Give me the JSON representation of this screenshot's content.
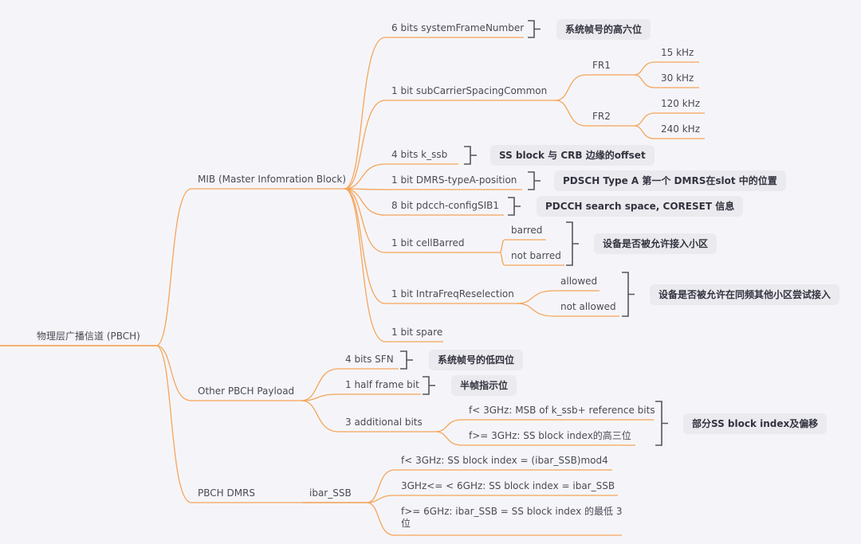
{
  "colors": {
    "background": "#f5f5f9",
    "branch": "#f5a55a",
    "text": "#4a4a55",
    "bracket": "#555560",
    "summary_bg": "#ebebef"
  },
  "root": {
    "id": "root",
    "label": "物理层广播信道 (PBCH)"
  },
  "nodes": [
    {
      "id": "mib",
      "parent": "root",
      "label": "MIB (Master Infomration Block)"
    },
    {
      "id": "other",
      "parent": "root",
      "label": "Other PBCH Payload"
    },
    {
      "id": "dmrs",
      "parent": "root",
      "label": "PBCH DMRS"
    },
    {
      "id": "sfn6",
      "parent": "mib",
      "label": "6 bits systemFrameNumber"
    },
    {
      "id": "scs",
      "parent": "mib",
      "label": "1 bit subCarrierSpacingCommon"
    },
    {
      "id": "kssb",
      "parent": "mib",
      "label": "4 bits k_ssb"
    },
    {
      "id": "dmrspos",
      "parent": "mib",
      "label": "1 bit DMRS-typeA-position"
    },
    {
      "id": "pdcch",
      "parent": "mib",
      "label": "8 bit pdcch-configSIB1"
    },
    {
      "id": "cellbarred",
      "parent": "mib",
      "label": "1 bit cellBarred"
    },
    {
      "id": "intrafreq",
      "parent": "mib",
      "label": "1 bit IntraFreqReselection"
    },
    {
      "id": "spare",
      "parent": "mib",
      "label": "1 bit spare"
    },
    {
      "id": "fr1",
      "parent": "scs",
      "label": "FR1"
    },
    {
      "id": "fr2",
      "parent": "scs",
      "label": "FR2"
    },
    {
      "id": "k15",
      "parent": "fr1",
      "label": "15 kHz"
    },
    {
      "id": "k30",
      "parent": "fr1",
      "label": "30 kHz"
    },
    {
      "id": "k120",
      "parent": "fr2",
      "label": "120 kHz"
    },
    {
      "id": "k240",
      "parent": "fr2",
      "label": "240 kHz"
    },
    {
      "id": "barred",
      "parent": "cellbarred",
      "label": "barred"
    },
    {
      "id": "notbarred",
      "parent": "cellbarred",
      "label": "not barred"
    },
    {
      "id": "allowed",
      "parent": "intrafreq",
      "label": "allowed"
    },
    {
      "id": "notallowed",
      "parent": "intrafreq",
      "label": "not allowed"
    },
    {
      "id": "sfn4",
      "parent": "other",
      "label": "4 bits SFN"
    },
    {
      "id": "halfframe",
      "parent": "other",
      "label": "1 half frame bit"
    },
    {
      "id": "addbits",
      "parent": "other",
      "label": "3 additional bits"
    },
    {
      "id": "lt3",
      "parent": "addbits",
      "label": "f< 3GHz: MSB of k_ssb+ reference bits"
    },
    {
      "id": "ge3",
      "parent": "addbits",
      "label": "f>= 3GHz: SS block index的高三位"
    },
    {
      "id": "ibar",
      "parent": "dmrs",
      "label": "ibar_SSB"
    },
    {
      "id": "d1",
      "parent": "ibar",
      "label": "f< 3GHz: SS block index = (ibar_SSB)mod4"
    },
    {
      "id": "d2",
      "parent": "ibar",
      "label": "3GHz<=  < 6GHz: SS block index = ibar_SSB"
    },
    {
      "id": "d3",
      "parent": "ibar",
      "label": "f>= 6GHz: ibar_SSB = SS block index 的最低 3 位"
    }
  ],
  "summaries": [
    {
      "id": "s_sfn6",
      "covers": [
        "sfn6"
      ],
      "label": "系统帧号的高六位"
    },
    {
      "id": "s_kssb",
      "covers": [
        "kssb"
      ],
      "label": "SS block 与 CRB 边缘的offset"
    },
    {
      "id": "s_dmrspos",
      "covers": [
        "dmrspos"
      ],
      "label": "PDSCH Type A 第一个 DMRS在slot 中的位置"
    },
    {
      "id": "s_pdcch",
      "covers": [
        "pdcch"
      ],
      "label": "PDCCH search space, CORESET 信息"
    },
    {
      "id": "s_barred",
      "covers": [
        "barred",
        "notbarred"
      ],
      "label": "设备是否被允许接入小区"
    },
    {
      "id": "s_intra",
      "covers": [
        "allowed",
        "notallowed"
      ],
      "label": "设备是否被允许在同频其他小区尝试接入"
    },
    {
      "id": "s_sfn4",
      "covers": [
        "sfn4"
      ],
      "label": "系统帧号的低四位"
    },
    {
      "id": "s_half",
      "covers": [
        "halfframe"
      ],
      "label": "半帧指示位"
    },
    {
      "id": "s_add",
      "covers": [
        "lt3",
        "ge3"
      ],
      "label": "部分SS block index及偏移"
    }
  ]
}
